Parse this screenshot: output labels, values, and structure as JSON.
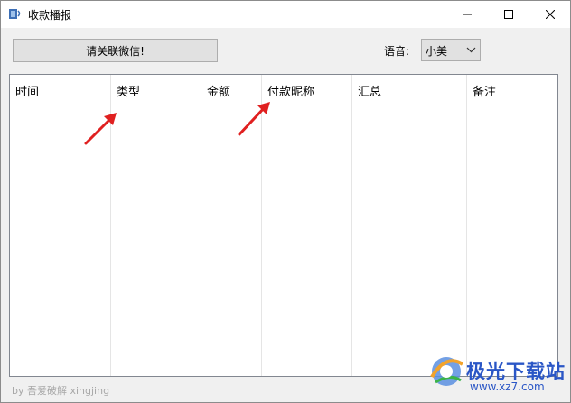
{
  "window": {
    "title": "收款播报",
    "controls": {
      "minimize": "minimize",
      "maximize": "maximize",
      "close": "close"
    }
  },
  "toolbar": {
    "contact_button": "请关联微信!",
    "voice_label": "语音:",
    "voice_value": "小美"
  },
  "table": {
    "columns": [
      "时间",
      "类型",
      "金额",
      "付款昵称",
      "汇总",
      "备注"
    ]
  },
  "footer": {
    "credit": "by 吾爱破解 xingjing"
  },
  "watermark": {
    "brand": "极光下载站",
    "url": "www.xz7.com"
  },
  "colors": {
    "arrow": "#e02020",
    "watermark": "#2a56c6"
  }
}
